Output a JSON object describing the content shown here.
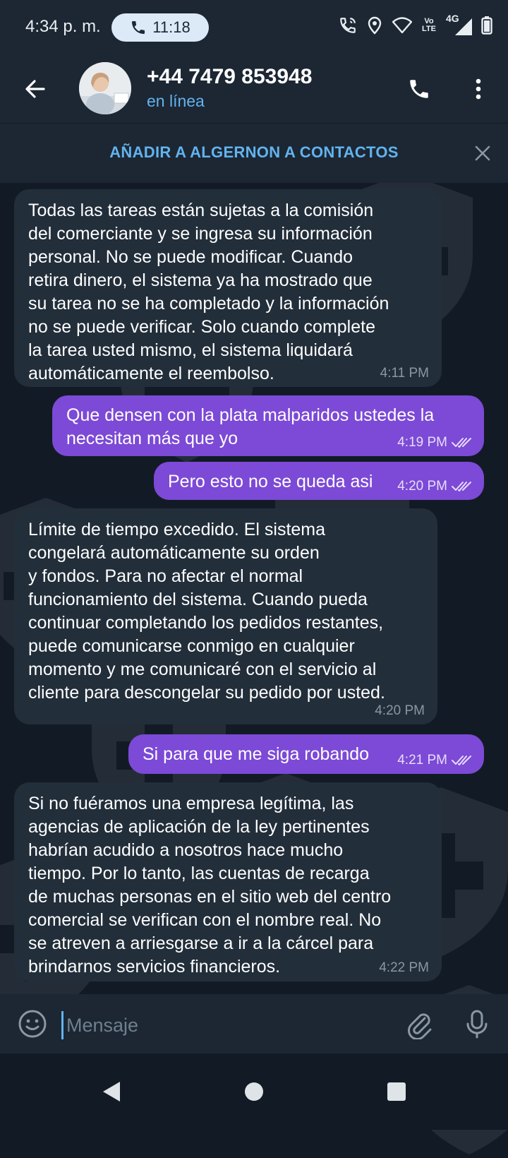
{
  "status_bar": {
    "time": "4:34 p. m.",
    "call_duration": "11:18",
    "network_label": "4G",
    "volte_label": "Vo\nLTE"
  },
  "header": {
    "contact_name": "+44 7479 853948",
    "contact_status": "en línea"
  },
  "add_contact_banner": {
    "label": "AÑADIR A ALGERNON A CONTACTOS"
  },
  "messages": [
    {
      "direction": "incoming",
      "text": "Todas las tareas están sujetas a la comisión\ndel comerciante y se ingresa su información\npersonal. No se puede modificar. Cuando\nretira dinero, el sistema ya ha mostrado que\nsu tarea no se ha completado y la información\nno se puede verificar. Solo cuando complete\nla tarea usted mismo, el sistema liquidará\nautomáticamente el reembolso.",
      "time": "4:11 PM"
    },
    {
      "direction": "outgoing",
      "text": "Que densen con la plata malparidos ustedes la\nnecesitan más que yo",
      "time": "4:19 PM",
      "status": "read"
    },
    {
      "direction": "outgoing",
      "text": "Pero esto no se queda asi",
      "time": "4:20 PM",
      "status": "read"
    },
    {
      "direction": "incoming",
      "text": "Límite de tiempo excedido. El sistema\ncongelará automáticamente su orden\ny fondos. Para no afectar el normal\nfuncionamiento del sistema. Cuando pueda\ncontinuar completando los pedidos restantes,\npuede comunicarse conmigo en cualquier\nmomento y me comunicaré con el servicio al\ncliente para descongelar su pedido por usted.",
      "time": "4:20 PM"
    },
    {
      "direction": "outgoing",
      "text": "Si para que me siga robando",
      "time": "4:21 PM",
      "status": "read"
    },
    {
      "direction": "incoming",
      "text": "Si no fuéramos una empresa legítima, las\nagencias de aplicación de la ley pertinentes\nhabrían acudido a nosotros hace mucho\ntiempo. Por lo tanto, las cuentas de recarga\nde muchas personas en el sitio web del centro\ncomercial se verifican con el nombre real. No\nse atreven a arriesgarse a ir a la cárcel para\nbrindarnos servicios financieros.",
      "time": "4:22 PM"
    }
  ],
  "composer": {
    "placeholder": "Mensaje",
    "value": ""
  },
  "colors": {
    "background": "#121b25",
    "bar": "#1c2733",
    "incoming_bubble": "#222e3a",
    "outgoing_bubble": "#7c4ad6",
    "accent": "#62b3ef"
  }
}
